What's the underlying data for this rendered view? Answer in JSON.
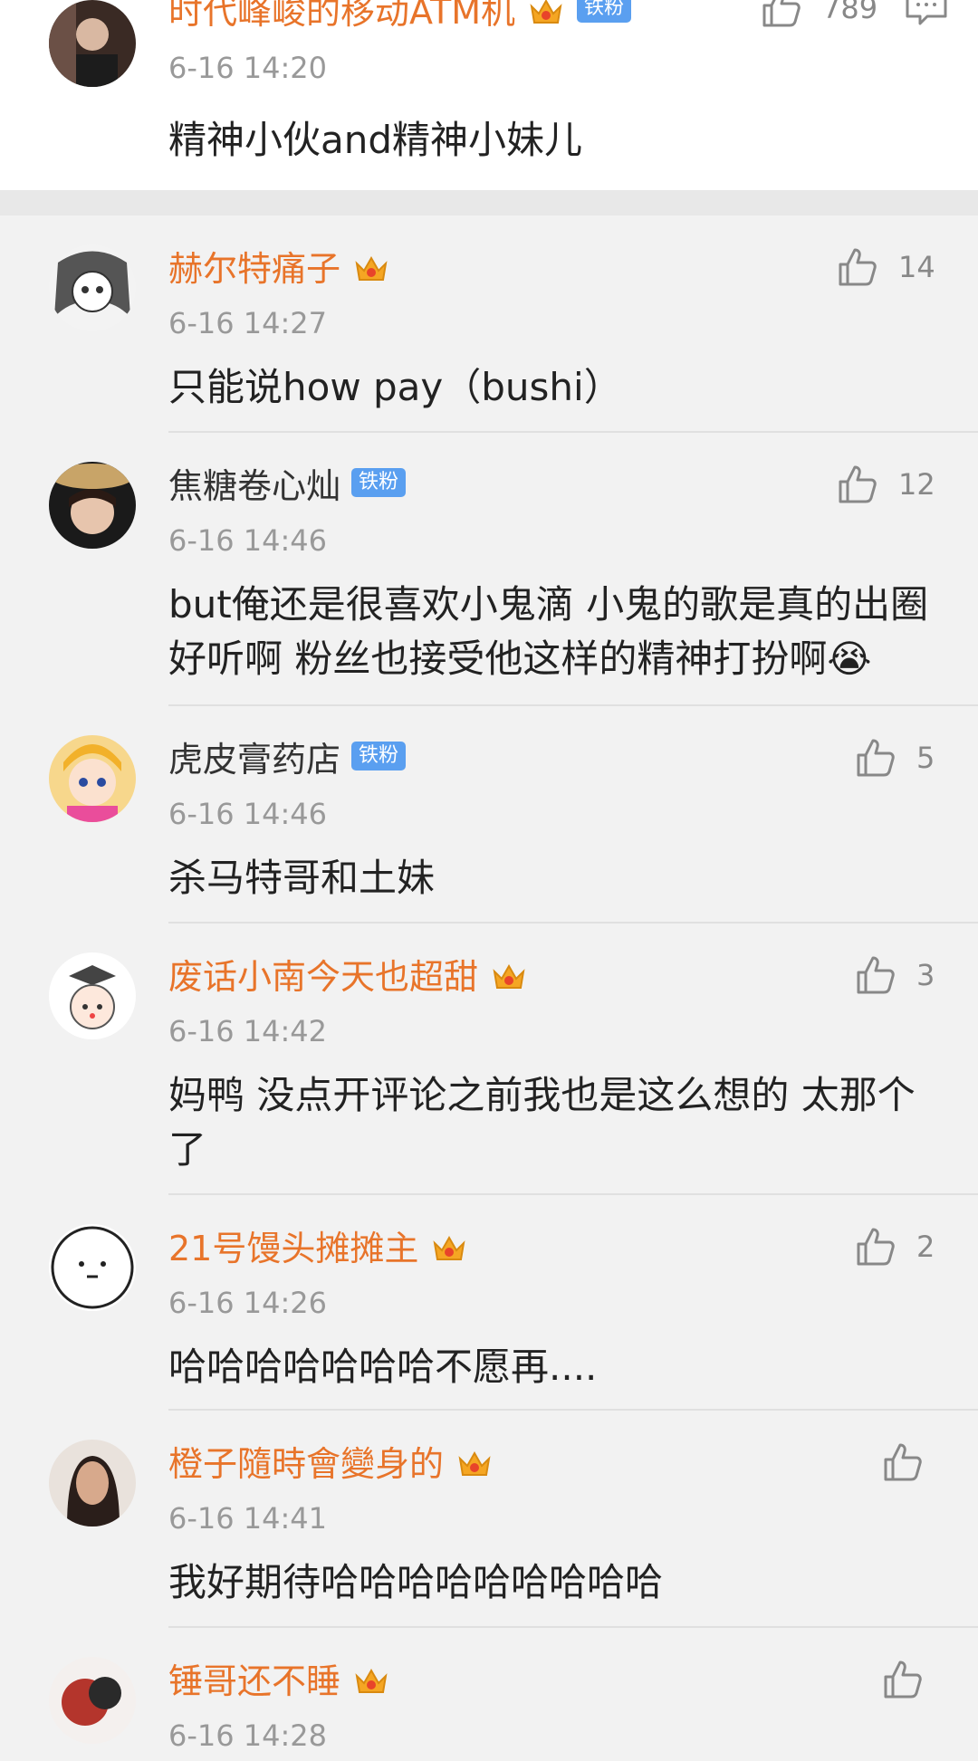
{
  "top_comment": {
    "username": "时代峰峻的移动ATM机",
    "crown_level": "5",
    "fan_badge": "铁粉",
    "likes": "789",
    "timestamp": "6-16 14:20",
    "text": "精神小伙and精神小妹儿"
  },
  "replies": [
    {
      "username": "赫尔特痛子",
      "badge": "crown",
      "level": "1",
      "timestamp": "6-16 14:27",
      "likes": "14",
      "text": "只能说how pay（bushi）"
    },
    {
      "username": "焦糖卷心灿",
      "badge": "fan",
      "fan_label": "铁粉",
      "timestamp": "6-16 14:46",
      "likes": "12",
      "text": "but俺还是很喜欢小鬼滴 小鬼的歌是真的出圈好听啊 粉丝也接受他这样的精神打扮啊😭"
    },
    {
      "username": "虎皮膏药店",
      "badge": "fan",
      "fan_label": "铁粉",
      "timestamp": "6-16 14:46",
      "likes": "5",
      "text": "杀马特哥和土妹"
    },
    {
      "username": "废话小南今天也超甜",
      "badge": "crown",
      "level": "6",
      "timestamp": "6-16 14:42",
      "likes": "3",
      "text": "妈鸭 没点开评论之前我也是这么想的 太那个了"
    },
    {
      "username": "21号馒头摊摊主",
      "badge": "crown",
      "level": "5",
      "timestamp": "6-16 14:26",
      "likes": "2",
      "text": "哈哈哈哈哈哈哈不愿再...."
    },
    {
      "username": "橙子隨時會變身的",
      "badge": "crown",
      "level": "4",
      "timestamp": "6-16 14:41",
      "likes": "",
      "text": "我好期待哈哈哈哈哈哈哈哈哈"
    },
    {
      "username": "锤哥还不睡",
      "badge": "crown",
      "level": "5",
      "timestamp": "6-16 14:28",
      "likes": "",
      "text": ""
    }
  ],
  "colors": {
    "username_orange": "#e8742a",
    "timestamp_gray": "#999999",
    "fan_badge_blue": "#5a9ff0"
  },
  "icons": {
    "like": "thumbs-up-icon",
    "reply": "comment-icon",
    "crown": "vip-crown-icon"
  }
}
